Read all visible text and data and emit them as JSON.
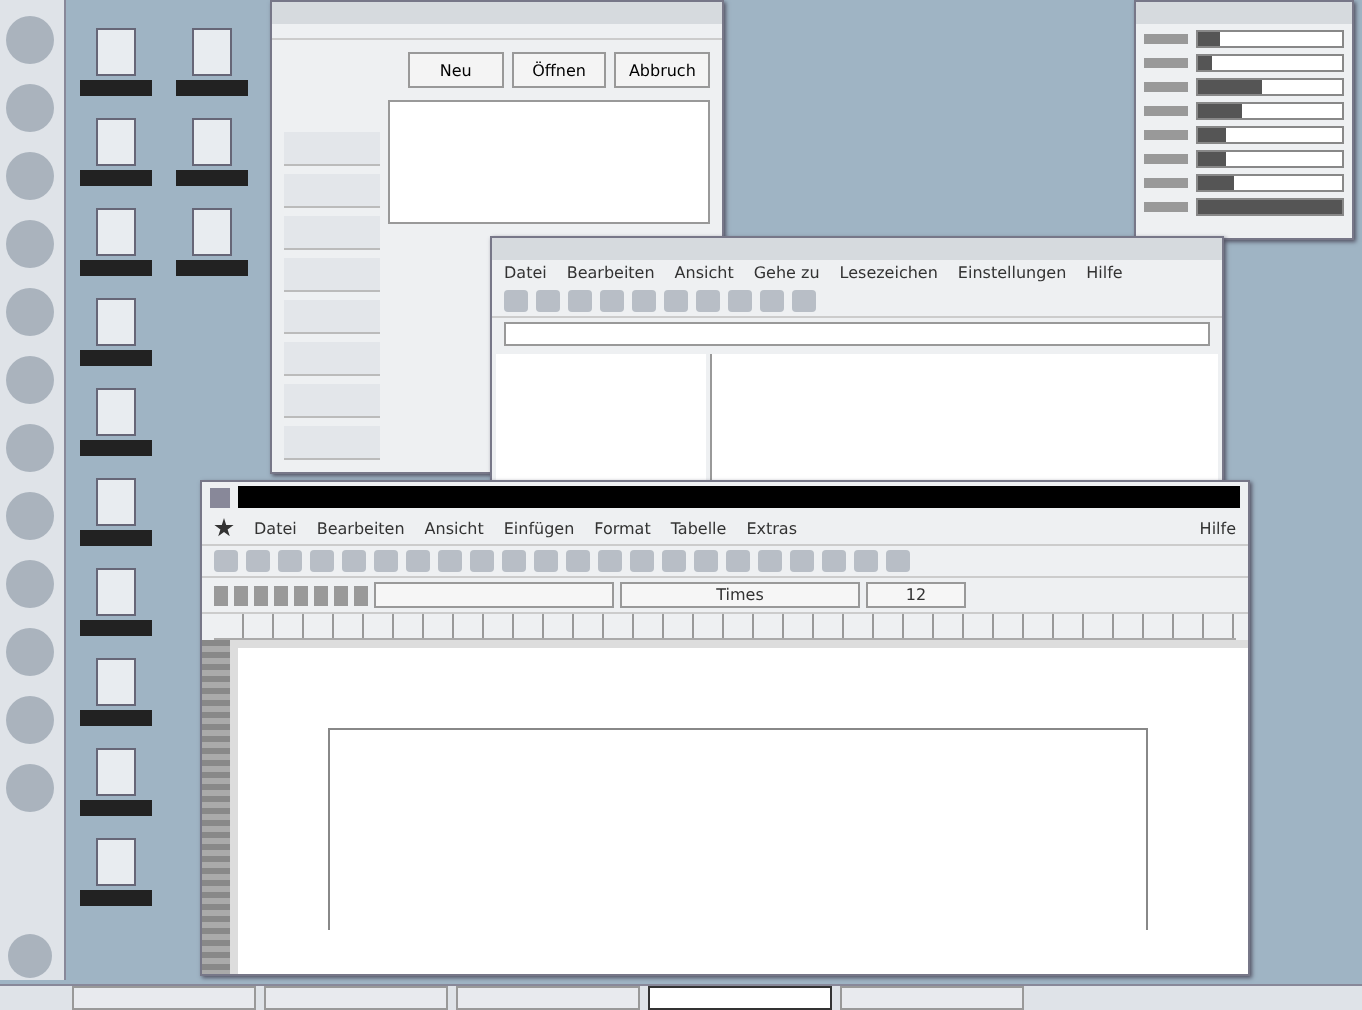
{
  "dialog": {
    "buttons": [
      "Neu",
      "Öffnen",
      "Abbruch"
    ]
  },
  "file_manager": {
    "menus": [
      "Datei",
      "Bearbeiten",
      "Ansicht",
      "Gehe zu",
      "Lesezeichen",
      "Einstellungen",
      "Hilfe"
    ]
  },
  "word_processor": {
    "menus": [
      "Datei",
      "Bearbeiten",
      "Ansicht",
      "Einfügen",
      "Format",
      "Tabelle",
      "Extras"
    ],
    "help_menu": "Hilfe",
    "font_name": "Times",
    "font_size": "12"
  },
  "monitor": {
    "meters": [
      {
        "level": 0.15
      },
      {
        "level": 0.1
      },
      {
        "level": 0.45
      },
      {
        "level": 0.3
      },
      {
        "level": 0.2
      },
      {
        "level": 0.2
      },
      {
        "level": 0.25
      },
      {
        "level": 1
      }
    ]
  },
  "taskbar": {
    "tasks": [
      {
        "selected": false
      },
      {
        "selected": false
      },
      {
        "selected": false
      },
      {
        "selected": true
      },
      {
        "selected": false
      }
    ]
  }
}
